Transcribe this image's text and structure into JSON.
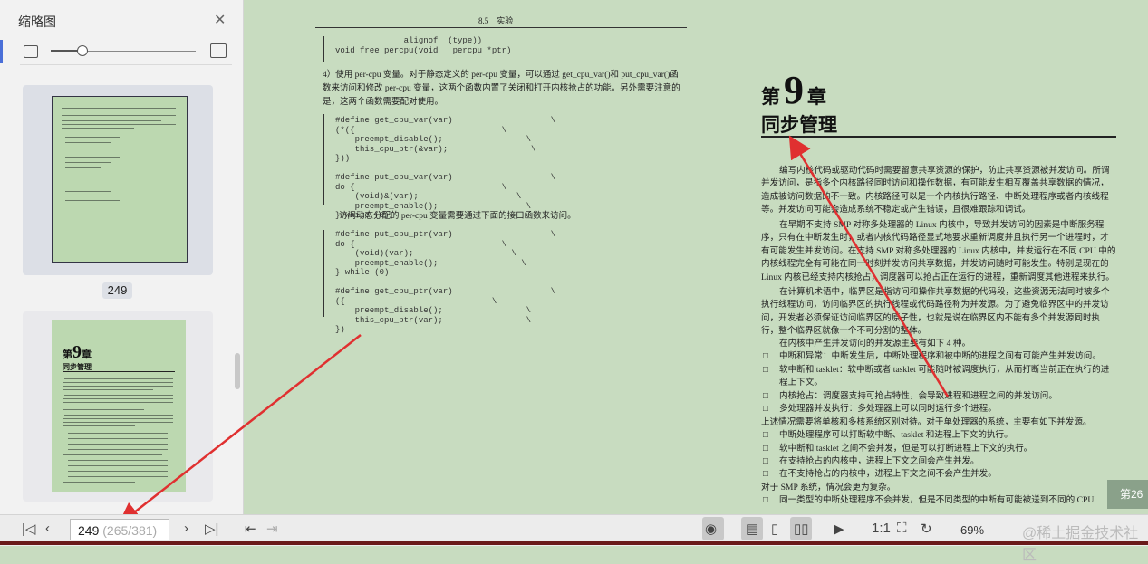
{
  "sidebar": {
    "title": "缩略图",
    "close_icon": "close-icon",
    "zoom_fraction": 0.22,
    "thumbnails": [
      {
        "page": "249"
      },
      {
        "chapter_prefix": "第",
        "chapter_num": "9",
        "chapter_suffix": "章",
        "chapter_title": "同步管理"
      }
    ]
  },
  "left_page": {
    "header": "8.5　实验",
    "code1": "            __alignof__(type))\nvoid free_percpu(void __percpu *ptr)",
    "para1": "4）使用 per-cpu 变量。对于静态定义的 per-cpu 变量，可以通过 get_cpu_var()和 put_cpu_var()函数来访问和修改 per-cpu 变量，这两个函数内置了关闭和打开内核抢占的功能。另外需要注意的是，这两个函数需要配对使用。",
    "code2": "#define get_cpu_var(var)                    \\\n(*({                              \\\n    preempt_disable();                 \\\n    this_cpu_ptr(&var);                 \\\n}))\n\n#define put_cpu_var(var)                    \\\ndo {                              \\\n    (void)&(var);                    \\\n    preempt_enable();                  \\\n} while (0)",
    "para2": "访问动态分配的 per-cpu 变量需要通过下面的接口函数来访问。",
    "code3": "#define put_cpu_ptr(var)                    \\\ndo {                              \\\n    (void)(var);                    \\\n    preempt_enable();                 \\\n} while (0)\n\n#define get_cpu_ptr(var)                    \\\n({                              \\\n    preempt_disable();                 \\\n    this_cpu_ptr(var);                 \\\n})",
    "footer_num": "249"
  },
  "right_page": {
    "chapter_prefix": "第",
    "chapter_num": "9",
    "chapter_suffix": "章",
    "chapter_title": "同步管理",
    "p1": "编写内核代码或驱动代码时需要留意共享资源的保护，防止共享资源被并发访问。所谓并发访问，是指多个内核路径同时访问和操作数据，有可能发生相互覆盖共享数据的情况，造成被访问数据的不一致。内核路径可以是一个内核执行路径、中断处理程序或者内核线程等。并发访问可能会造成系统不稳定或产生错误，且很难跟踪和调试。",
    "p2": "在早期不支持 SMP 对称多处理器的 Linux 内核中，导致并发访问的因素是中断服务程序，只有在中断发生时，或者内核代码路径显式地要求重新调度并且执行另一个进程时，才有可能发生并发访问。在支持 SMP 对称多处理器的 Linux 内核中，并发运行在不同 CPU 中的内核线程完全有可能在同一时刻并发访问共享数据，并发访问随时可能发生。特别是现在的 Linux 内核已经支持内核抢占，调度器可以抢占正在运行的进程，重新调度其他进程来执行。",
    "p3": "在计算机术语中，临界区是指访问和操作共享数据的代码段，这些资源无法同时被多个执行线程访问，访问临界区的执行线程或代码路径称为并发源。为了避免临界区中的并发访问，开发者必须保证访问临界区的原子性，也就是说在临界区内不能有多个并发源同时执行，整个临界区就像一个不可分割的整体。",
    "p4": "在内核中产生并发访问的并发源主要有如下 4 种。",
    "bullets1": [
      "中断和异常：中断发生后，中断处理程序和被中断的进程之间有可能产生并发访问。",
      "软中断和 tasklet：软中断或者 tasklet 可能随时被调度执行，从而打断当前正在执行的进程上下文。",
      "内核抢占：调度器支持可抢占特性，会导致进程和进程之间的并发访问。",
      "多处理器并发执行：多处理器上可以同时运行多个进程。"
    ],
    "p5": "上述情况需要将单核和多核系统区别对待。对于单处理器的系统，主要有如下并发源。",
    "bullets2": [
      "中断处理程序可以打断软中断、tasklet 和进程上下文的执行。",
      "软中断和 tasklet 之间不会并发，但是可以打断进程上下文的执行。",
      "在支持抢占的内核中，进程上下文之间会产生并发。",
      "在不支持抢占的内核中，进程上下文之间不会产生并发。"
    ],
    "p6": "对于 SMP 系统，情况会更为复杂。",
    "bullets3": [
      "同一类型的中断处理程序不会并发，但是不同类型的中断有可能被送到不同的 CPU"
    ]
  },
  "side_badge": "第26",
  "bottom": {
    "page_current": "249",
    "page_total": " (265/381)",
    "zoom": "69%",
    "watermark": "@稀土掘金技术社区"
  },
  "colors": {
    "annotation": "#e03030",
    "page_bg": "#c8dcc0",
    "accent": "#4a6fd8"
  }
}
